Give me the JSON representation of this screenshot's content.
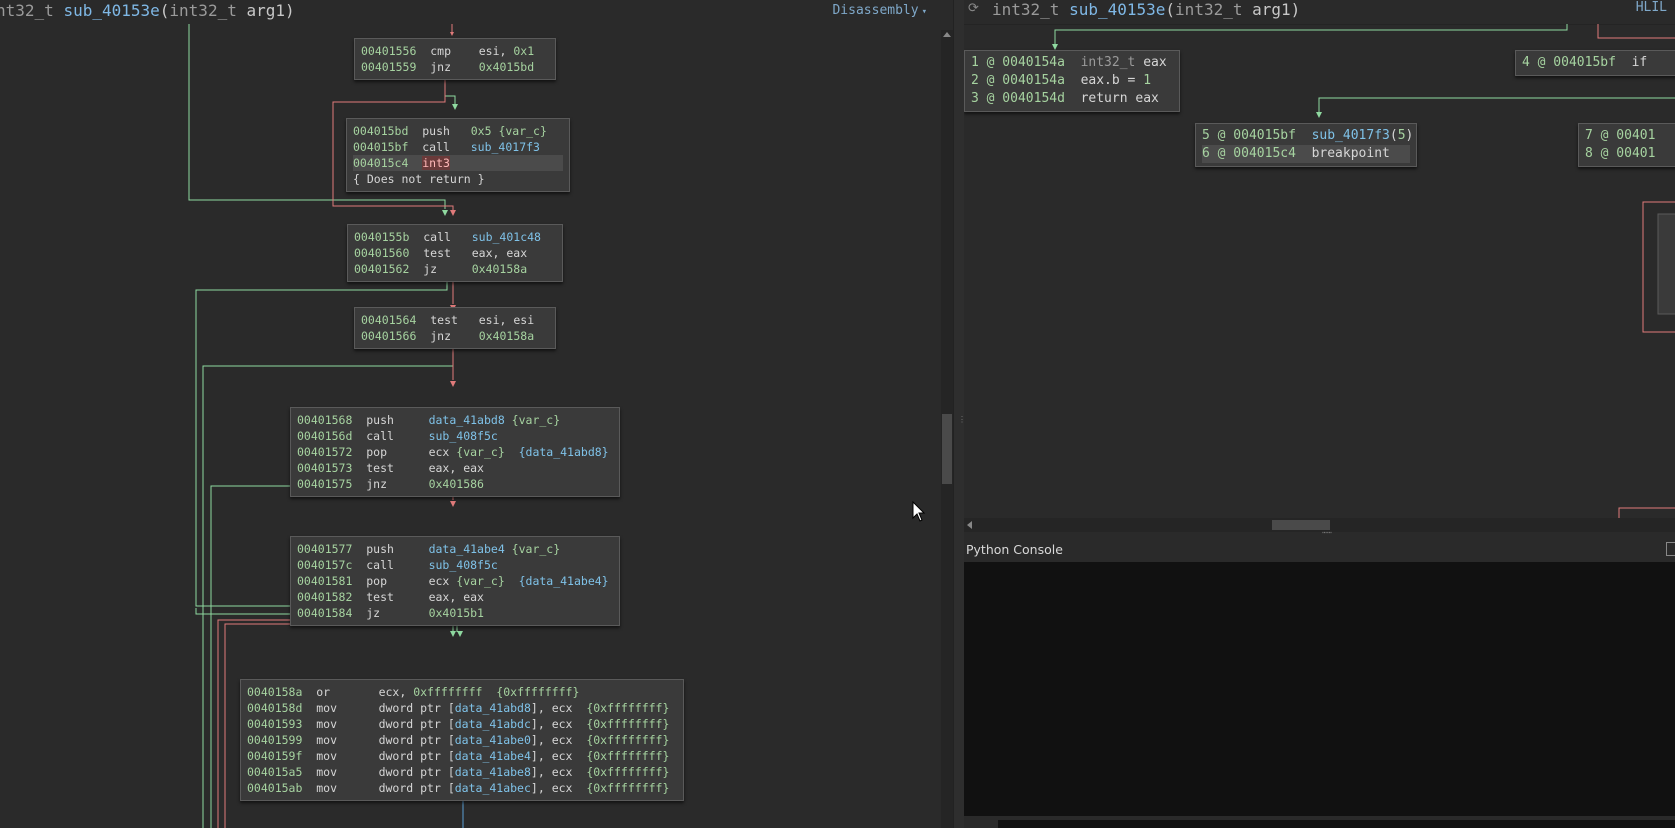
{
  "left_view": {
    "title_type": "nt32_t",
    "title_func": "sub_40153e",
    "title_params_type": "int32_t",
    "title_params_name": "arg1",
    "view_mode": "Disassembly"
  },
  "blocks": [
    {
      "lines": [
        {
          "addr": "00401556",
          "op": "cmp",
          "args": [
            {
              "t": "esi, ",
              "c": "arg"
            },
            {
              "t": "0x1",
              "c": "num"
            }
          ]
        },
        {
          "addr": "00401559",
          "op": "jnz",
          "args": [
            {
              "t": "0x4015bd",
              "c": "num"
            }
          ]
        }
      ]
    },
    {
      "lines": [
        {
          "addr": "004015bd",
          "op": "push",
          "args": [
            {
              "t": "0x5 ",
              "c": "num"
            },
            {
              "t": "{var_c}",
              "c": "num"
            }
          ]
        },
        {
          "addr": "004015bf",
          "op": "call",
          "args": [
            {
              "t": "sub_4017f3",
              "c": "sym"
            }
          ]
        },
        {
          "addr": "004015c4",
          "op": "int3",
          "args": [],
          "highlight": true
        },
        {
          "addr": "{ Does not return }",
          "op": "",
          "args": [],
          "note": true
        }
      ]
    },
    {
      "lines": [
        {
          "addr": "0040155b",
          "op": "call",
          "args": [
            {
              "t": "sub_401c48",
              "c": "sym"
            }
          ]
        },
        {
          "addr": "00401560",
          "op": "test",
          "args": [
            {
              "t": "eax, eax",
              "c": "arg"
            }
          ]
        },
        {
          "addr": "00401562",
          "op": "jz",
          "args": [
            {
              "t": "0x40158a",
              "c": "num"
            }
          ]
        }
      ]
    },
    {
      "lines": [
        {
          "addr": "00401564",
          "op": "test",
          "args": [
            {
              "t": "esi, esi",
              "c": "arg"
            }
          ]
        },
        {
          "addr": "00401566",
          "op": "jnz",
          "args": [
            {
              "t": "0x40158a",
              "c": "num"
            }
          ]
        }
      ]
    },
    {
      "lines": [
        {
          "addr": "00401568",
          "op": "push",
          "args": [
            {
              "t": "data_41abd8 ",
              "c": "sym"
            },
            {
              "t": "{var_c}",
              "c": "num"
            }
          ]
        },
        {
          "addr": "0040156d",
          "op": "call",
          "args": [
            {
              "t": "sub_408f5c",
              "c": "sym"
            }
          ]
        },
        {
          "addr": "00401572",
          "op": "pop",
          "args": [
            {
              "t": "ecx ",
              "c": "arg"
            },
            {
              "t": "{var_c}  ",
              "c": "num"
            },
            {
              "t": "{data_41abd8}",
              "c": "sym"
            }
          ]
        },
        {
          "addr": "00401573",
          "op": "test",
          "args": [
            {
              "t": "eax, eax",
              "c": "arg"
            }
          ]
        },
        {
          "addr": "00401575",
          "op": "jnz",
          "args": [
            {
              "t": "0x401586",
              "c": "num"
            }
          ]
        }
      ]
    },
    {
      "lines": [
        {
          "addr": "00401577",
          "op": "push",
          "args": [
            {
              "t": "data_41abe4 ",
              "c": "sym"
            },
            {
              "t": "{var_c}",
              "c": "num"
            }
          ]
        },
        {
          "addr": "0040157c",
          "op": "call",
          "args": [
            {
              "t": "sub_408f5c",
              "c": "sym"
            }
          ]
        },
        {
          "addr": "00401581",
          "op": "pop",
          "args": [
            {
              "t": "ecx ",
              "c": "arg"
            },
            {
              "t": "{var_c}  ",
              "c": "num"
            },
            {
              "t": "{data_41abe4}",
              "c": "sym"
            }
          ]
        },
        {
          "addr": "00401582",
          "op": "test",
          "args": [
            {
              "t": "eax, eax",
              "c": "arg"
            }
          ]
        },
        {
          "addr": "00401584",
          "op": "jz",
          "args": [
            {
              "t": "0x4015b1",
              "c": "num"
            }
          ]
        }
      ]
    },
    {
      "lines": [
        {
          "addr": "0040158a",
          "op": "or",
          "args": [
            {
              "t": "ecx, ",
              "c": "arg"
            },
            {
              "t": "0xffffffff  ",
              "c": "num"
            },
            {
              "t": "{0xffffffff}",
              "c": "num"
            }
          ]
        },
        {
          "addr": "0040158d",
          "op": "mov",
          "args": [
            {
              "t": "dword ptr [",
              "c": "arg"
            },
            {
              "t": "data_41abd8",
              "c": "sym"
            },
            {
              "t": "], ecx  ",
              "c": "arg"
            },
            {
              "t": "{0xffffffff}",
              "c": "num"
            }
          ]
        },
        {
          "addr": "00401593",
          "op": "mov",
          "args": [
            {
              "t": "dword ptr [",
              "c": "arg"
            },
            {
              "t": "data_41abdc",
              "c": "sym"
            },
            {
              "t": "], ecx  ",
              "c": "arg"
            },
            {
              "t": "{0xffffffff}",
              "c": "num"
            }
          ]
        },
        {
          "addr": "00401599",
          "op": "mov",
          "args": [
            {
              "t": "dword ptr [",
              "c": "arg"
            },
            {
              "t": "data_41abe0",
              "c": "sym"
            },
            {
              "t": "], ecx  ",
              "c": "arg"
            },
            {
              "t": "{0xffffffff}",
              "c": "num"
            }
          ]
        },
        {
          "addr": "0040159f",
          "op": "mov",
          "args": [
            {
              "t": "dword ptr [",
              "c": "arg"
            },
            {
              "t": "data_41abe4",
              "c": "sym"
            },
            {
              "t": "], ecx  ",
              "c": "arg"
            },
            {
              "t": "{0xffffffff}",
              "c": "num"
            }
          ]
        },
        {
          "addr": "004015a5",
          "op": "mov",
          "args": [
            {
              "t": "dword ptr [",
              "c": "arg"
            },
            {
              "t": "data_41abe8",
              "c": "sym"
            },
            {
              "t": "], ecx  ",
              "c": "arg"
            },
            {
              "t": "{0xffffffff}",
              "c": "num"
            }
          ]
        },
        {
          "addr": "004015ab",
          "op": "mov",
          "args": [
            {
              "t": "dword ptr [",
              "c": "arg"
            },
            {
              "t": "data_41abec",
              "c": "sym"
            },
            {
              "t": "], ecx  ",
              "c": "arg"
            },
            {
              "t": "{0xffffffff}",
              "c": "num"
            }
          ]
        }
      ]
    }
  ],
  "right_view": {
    "title_type": "int32_t",
    "title_func": "sub_40153e",
    "title_params_type": "int32_t",
    "title_params_name": "arg1",
    "view_mode": "HLIL",
    "sync_icon": "sync-icon"
  },
  "hlil_blocks": [
    {
      "lines": [
        {
          "idx": "1 @ 0040154a",
          "parts": [
            {
              "t": "int32_t ",
              "c": "type"
            },
            {
              "t": "eax",
              "c": "arg"
            }
          ]
        },
        {
          "idx": "2 @ 0040154a",
          "parts": [
            {
              "t": "eax.b = ",
              "c": "arg"
            },
            {
              "t": "1",
              "c": "num"
            }
          ]
        },
        {
          "idx": "3 @ 0040154d",
          "parts": [
            {
              "t": "return eax",
              "c": "arg"
            }
          ]
        }
      ]
    },
    {
      "lines": [
        {
          "idx": "4 @ 004015bf",
          "parts": [
            {
              "t": "if",
              "c": "arg"
            }
          ]
        }
      ]
    },
    {
      "lines": [
        {
          "idx": "5 @ 004015bf",
          "parts": [
            {
              "t": "sub_4017f3",
              "c": "sym"
            },
            {
              "t": "(",
              "c": "arg"
            },
            {
              "t": "5",
              "c": "num"
            },
            {
              "t": ")",
              "c": "arg"
            }
          ]
        },
        {
          "idx": "6 @ 004015c4",
          "parts": [
            {
              "t": "breakpoint",
              "c": "arg"
            }
          ],
          "highlight": true
        }
      ]
    },
    {
      "lines": [
        {
          "idx": "7 @ 00401",
          "parts": []
        },
        {
          "idx": "8 @ 00401",
          "parts": []
        }
      ]
    }
  ],
  "console": {
    "title": "Python Console"
  },
  "colors": {
    "edge_green": "#8fd9a0",
    "edge_red": "#e07a7a",
    "edge_blue": "#5a9fd4",
    "background": "#2a2a2a",
    "block_bg": "#3a3a3a"
  }
}
